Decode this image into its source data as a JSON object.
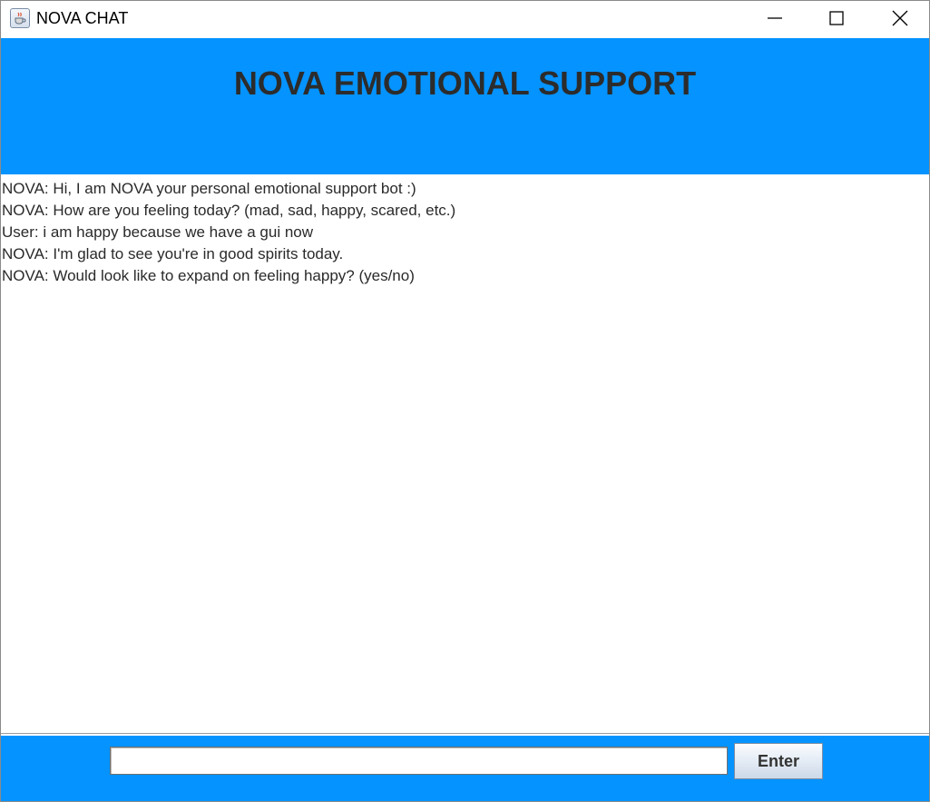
{
  "window": {
    "title": "NOVA CHAT",
    "icon": "java-cup-icon",
    "controls": [
      "minimize-icon",
      "maximize-icon",
      "close-icon"
    ]
  },
  "header": {
    "title": "NOVA EMOTIONAL SUPPORT"
  },
  "chat": {
    "messages": [
      "NOVA: Hi, I am NOVA your personal emotional support bot :)",
      "NOVA: How are you feeling today? (mad, sad, happy, scared, etc.)",
      "User: i am happy because we have a gui now",
      "NOVA: I'm glad to see you're in good spirits today.",
      "NOVA: Would look like to expand on feeling happy? (yes/no)"
    ]
  },
  "input": {
    "value": "",
    "placeholder": ""
  },
  "enter_button": {
    "label": "Enter"
  },
  "colors": {
    "accent": "#0593ff",
    "title_text": "#2c2c2c",
    "message_text": "#2a2a2a"
  }
}
